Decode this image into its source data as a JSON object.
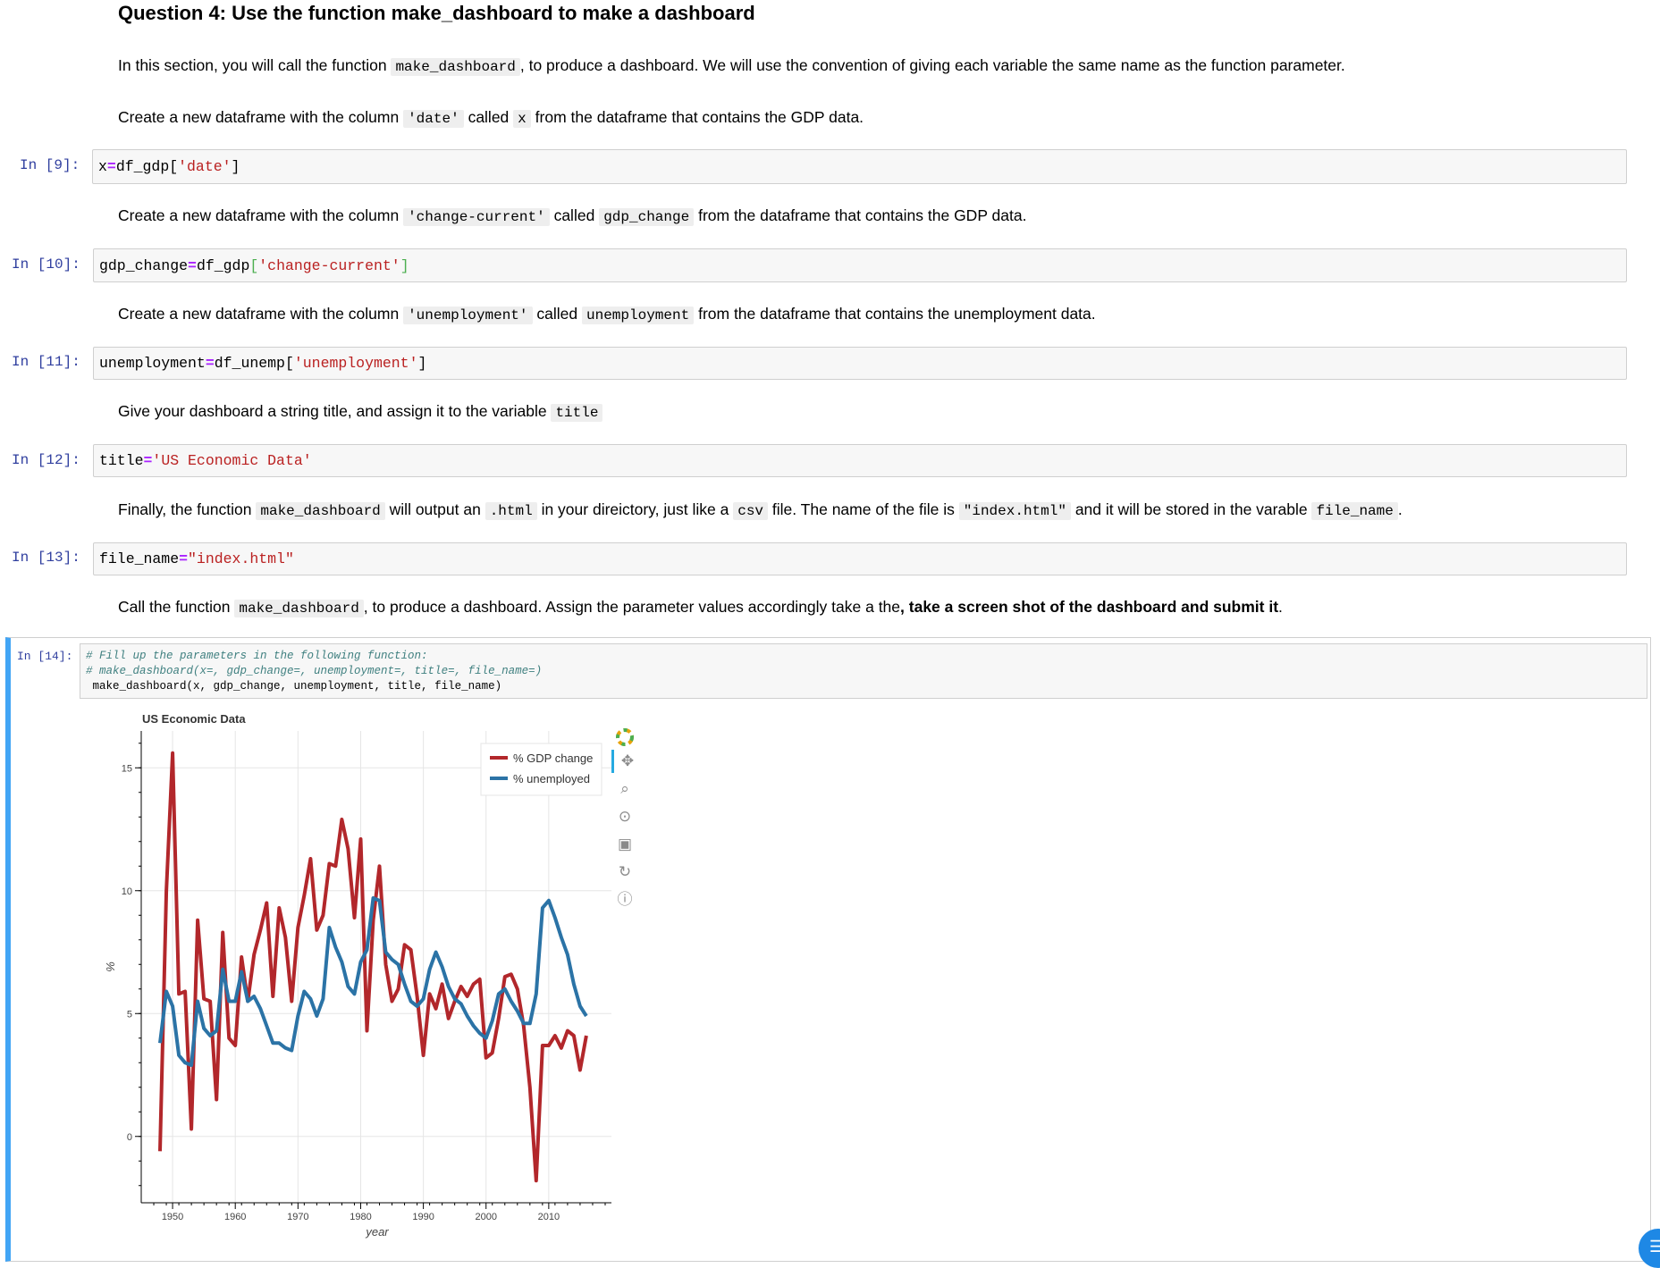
{
  "heading": "Question 4: Use the function make_dashboard to make a dashboard",
  "intro": {
    "p1": "In this section, you will call the function",
    "code": "make_dashboard",
    "p2": ", to produce a dashboard. We will use the convention of giving each variable the same name as the function parameter."
  },
  "task_x": {
    "p1": "Create a new dataframe with the column",
    "col": "'date'",
    "p2": "called",
    "var": "x",
    "p3": "from the dataframe that contains the GDP data."
  },
  "cell9": {
    "prompt": "In [9]:",
    "var": "x",
    "op": "=",
    "obj": "df_gdp[",
    "str": "'date'",
    "close": "]"
  },
  "task_gdp": {
    "p1": "Create a new dataframe with the column",
    "col": "'change-current'",
    "p2": "called",
    "var": "gdp_change",
    "p3": "from the dataframe that contains the GDP data."
  },
  "cell10": {
    "prompt": "In [10]:",
    "var": "gdp_change",
    "op": "=",
    "obj": "df_gdp",
    "open": "[",
    "str": "'change-current'",
    "close": "]"
  },
  "task_unemp": {
    "p1": "Create a new dataframe with the column",
    "col": "'unemployment'",
    "p2": "called",
    "var": "unemployment",
    "p3": "from the dataframe that contains the unemployment data."
  },
  "cell11": {
    "prompt": "In [11]:",
    "var": "unemployment",
    "op": "=",
    "obj": "df_unemp[",
    "str": "'unemployment'",
    "close": "]"
  },
  "task_title": {
    "p1": "Give your dashboard a string title, and assign it to the variable",
    "var": "title"
  },
  "cell12": {
    "prompt": "In [12]:",
    "var": "title",
    "op": "=",
    "str": "'US Economic Data'"
  },
  "task_file": {
    "p1": "Finally, the function",
    "code1": "make_dashboard",
    "p2": "will output an",
    "code2": ".html",
    "p3": "in your direictory, just like a",
    "code3": "csv",
    "p4": "file. The name of the file is",
    "code4": "\"index.html\"",
    "p5": "and it will be stored in the varable",
    "code5": "file_name",
    "p6": "."
  },
  "cell13": {
    "prompt": "In [13]:",
    "var": "file_name",
    "op": "=",
    "str": "\"index.html\""
  },
  "task_call": {
    "p1": "Call the function",
    "code": "make_dashboard",
    "p2": ", to produce a dashboard. Assign the parameter values accordingly take a the",
    "bold": ", take a screen shot of the dashboard and submit it",
    "p3": "."
  },
  "cell14": {
    "prompt": "In [14]:",
    "comment1": "# Fill up the parameters in the following function:",
    "comment2": "# make_dashboard(x=, gdp_change=, unemployment=, title=, file_name=)",
    "code": " make_dashboard(x, gdp_change, unemployment, title, file_name)"
  },
  "colors": {
    "gdp": "#b2272b",
    "unemp": "#2b73a6",
    "prompt": "#303f9f",
    "accent": "#42a5f5"
  },
  "toolbar_icons": [
    "bokeh-logo-icon",
    "pan-icon",
    "box-zoom-icon",
    "wheel-zoom-icon",
    "save-icon",
    "reset-icon",
    "help-icon"
  ],
  "chart_data": {
    "type": "line",
    "title": "US Economic Data",
    "xlabel": "year",
    "ylabel": "%",
    "xlim": [
      1945,
      2020
    ],
    "ylim": [
      -2.7,
      16.5
    ],
    "xticks": [
      1950,
      1960,
      1970,
      1980,
      1990,
      2000,
      2010
    ],
    "yticks": [
      0,
      5,
      10,
      15
    ],
    "grid": true,
    "legend_position": "top-right",
    "series": [
      {
        "name": "% GDP change",
        "x": [
          1948,
          1949,
          1950,
          1951,
          1952,
          1953,
          1954,
          1955,
          1956,
          1957,
          1958,
          1959,
          1960,
          1961,
          1962,
          1963,
          1964,
          1965,
          1966,
          1967,
          1968,
          1969,
          1970,
          1971,
          1972,
          1973,
          1974,
          1975,
          1976,
          1977,
          1978,
          1979,
          1980,
          1981,
          1982,
          1983,
          1984,
          1985,
          1986,
          1987,
          1988,
          1989,
          1990,
          1991,
          1992,
          1993,
          1994,
          1995,
          1996,
          1997,
          1998,
          1999,
          2000,
          2001,
          2002,
          2003,
          2004,
          2005,
          2006,
          2007,
          2008,
          2009,
          2010,
          2011,
          2012,
          2013,
          2014,
          2015,
          2016
        ],
        "values": [
          -0.6,
          10.0,
          15.6,
          5.8,
          5.9,
          0.3,
          8.8,
          5.6,
          5.5,
          1.5,
          8.3,
          4.0,
          3.7,
          7.3,
          5.5,
          7.4,
          8.4,
          9.5,
          5.7,
          9.3,
          8.1,
          5.5,
          8.5,
          9.8,
          11.3,
          8.4,
          9.0,
          11.1,
          11.0,
          12.9,
          11.7,
          8.9,
          12.1,
          4.3,
          8.8,
          11.0,
          7.0,
          5.5,
          6.0,
          7.8,
          7.6,
          5.7,
          3.3,
          5.8,
          5.2,
          6.2,
          4.8,
          5.5,
          6.1,
          5.7,
          6.2,
          6.4,
          3.2,
          3.4,
          4.8,
          6.5,
          6.6,
          6.0,
          4.5,
          2.0,
          -1.8,
          3.7,
          3.7,
          4.1,
          3.6,
          4.3,
          4.1,
          2.7,
          4.1
        ]
      },
      {
        "name": "% unemployed",
        "x": [
          1948,
          1949,
          1950,
          1951,
          1952,
          1953,
          1954,
          1955,
          1956,
          1957,
          1958,
          1959,
          1960,
          1961,
          1962,
          1963,
          1964,
          1965,
          1966,
          1967,
          1968,
          1969,
          1970,
          1971,
          1972,
          1973,
          1974,
          1975,
          1976,
          1977,
          1978,
          1979,
          1980,
          1981,
          1982,
          1983,
          1984,
          1985,
          1986,
          1987,
          1988,
          1989,
          1990,
          1991,
          1992,
          1993,
          1994,
          1995,
          1996,
          1997,
          1998,
          1999,
          2000,
          2001,
          2002,
          2003,
          2004,
          2005,
          2006,
          2007,
          2008,
          2009,
          2010,
          2011,
          2012,
          2013,
          2014,
          2015,
          2016
        ],
        "values": [
          3.8,
          5.9,
          5.3,
          3.3,
          3.0,
          2.9,
          5.5,
          4.4,
          4.1,
          4.3,
          6.8,
          5.5,
          5.5,
          6.7,
          5.5,
          5.7,
          5.2,
          4.5,
          3.8,
          3.8,
          3.6,
          3.5,
          4.9,
          5.9,
          5.6,
          4.9,
          5.6,
          8.5,
          7.7,
          7.1,
          6.1,
          5.8,
          7.1,
          7.6,
          9.7,
          9.6,
          7.5,
          7.2,
          7.0,
          6.2,
          5.5,
          5.3,
          5.6,
          6.8,
          7.5,
          6.9,
          6.1,
          5.6,
          5.4,
          4.9,
          4.5,
          4.2,
          4.0,
          4.7,
          5.8,
          6.0,
          5.5,
          5.1,
          4.6,
          4.6,
          5.8,
          9.3,
          9.6,
          8.9,
          8.1,
          7.4,
          6.2,
          5.3,
          4.9
        ]
      }
    ]
  }
}
